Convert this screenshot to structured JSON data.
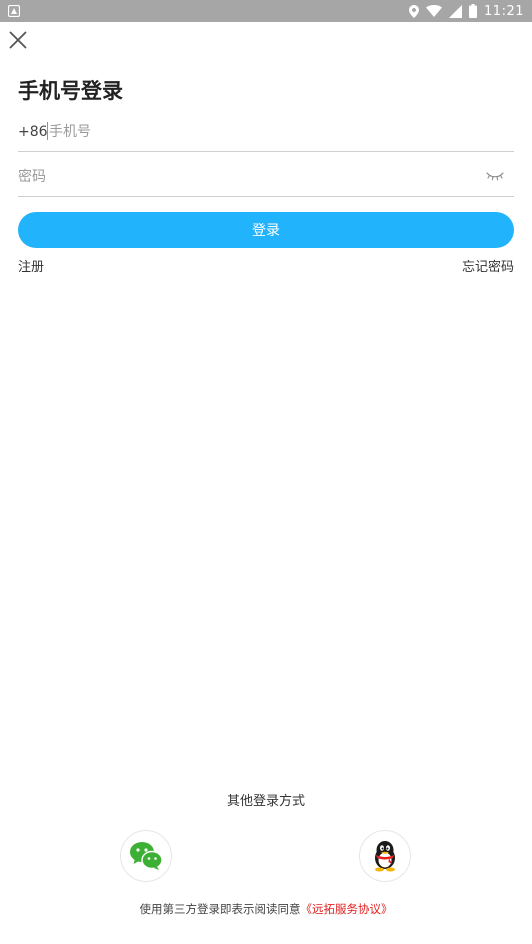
{
  "status_bar": {
    "time": "11:21",
    "icons": [
      "notification-icon",
      "location-icon",
      "wifi-icon",
      "signal-icon",
      "battery-icon"
    ]
  },
  "header": {
    "close_icon": "close-icon"
  },
  "login": {
    "title": "手机号登录",
    "country_code": "+86",
    "phone_placeholder": "手机号",
    "phone_value": "",
    "password_placeholder": "密码",
    "password_value": "",
    "password_toggle_icon": "eye-closed-icon",
    "login_button": "登录",
    "register_link": "注册",
    "forgot_link": "忘记密码"
  },
  "other_login": {
    "label": "其他登录方式",
    "options": [
      {
        "name": "wechat",
        "icon": "wechat-icon"
      },
      {
        "name": "qq",
        "icon": "qq-icon"
      }
    ]
  },
  "agreement": {
    "prefix": "使用第三方登录即表示阅读同意",
    "link_text": "《远拓服务协议》"
  },
  "colors": {
    "primary": "#21b3fb",
    "status_bar": "#a6a6a6",
    "link_red": "#e0201e",
    "wechat_green": "#3cb034"
  }
}
